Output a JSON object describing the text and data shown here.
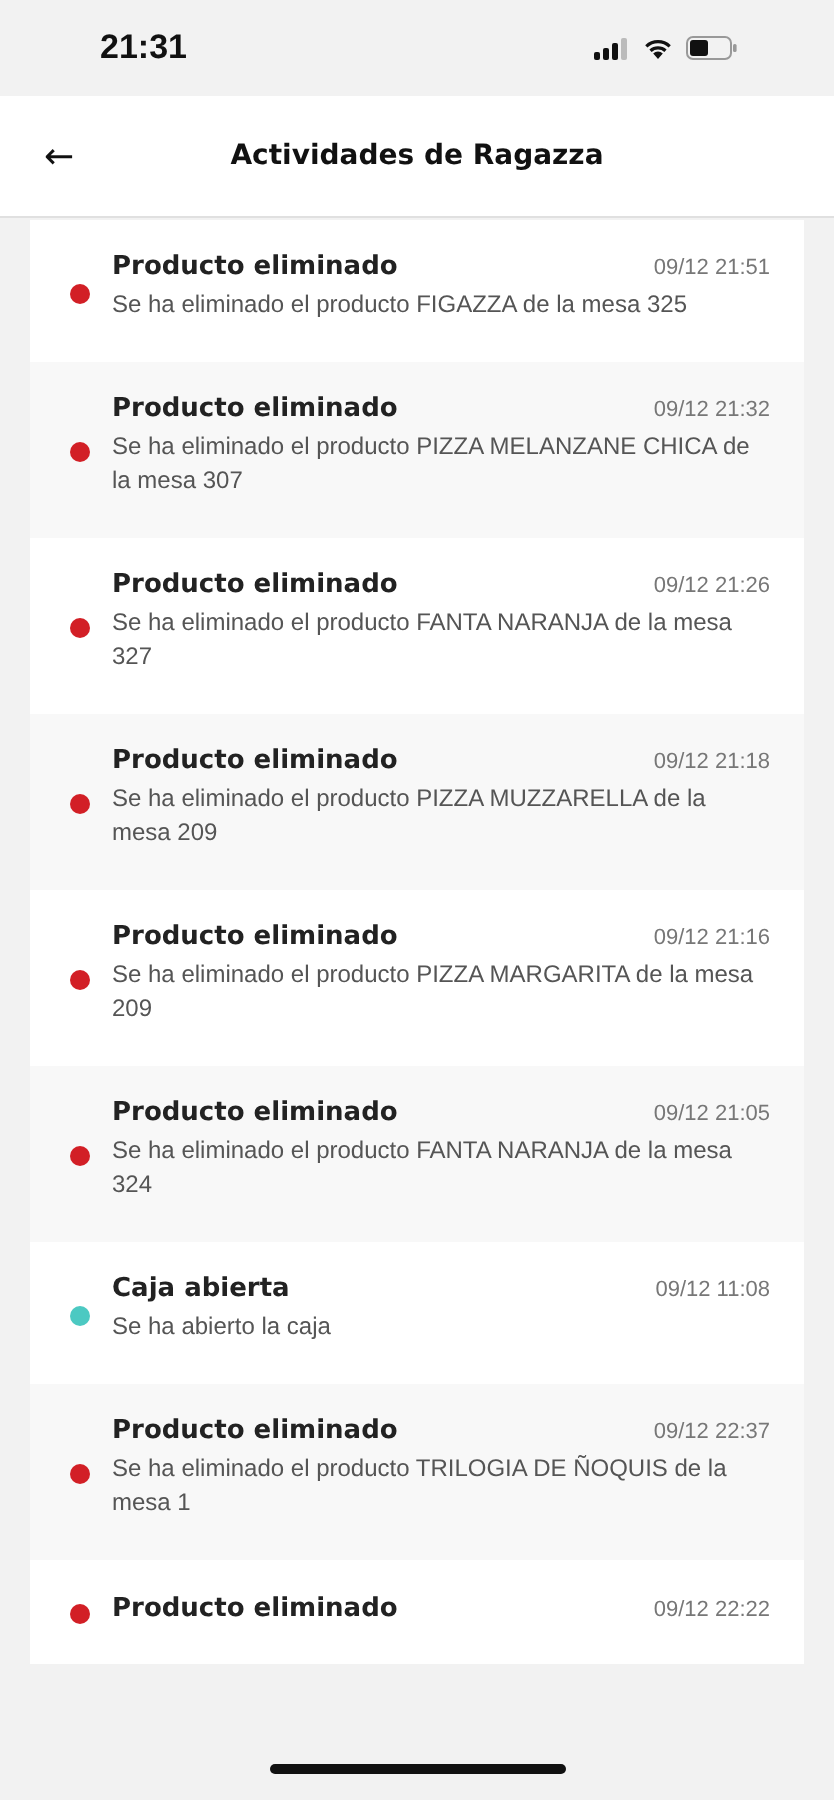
{
  "status_bar": {
    "time": "21:31"
  },
  "header": {
    "back": "←",
    "title": "Actividades de Ragazza"
  },
  "activities": [
    {
      "title": "Producto eliminado",
      "time": "09/12 21:51",
      "description": "Se ha eliminado el producto FIGAZZA de la mesa 325",
      "color": "#d21f26"
    },
    {
      "title": "Producto eliminado",
      "time": "09/12 21:32",
      "description": "Se ha eliminado el producto PIZZA MELANZANE CHICA de la mesa 307",
      "color": "#d21f26"
    },
    {
      "title": "Producto eliminado",
      "time": "09/12 21:26",
      "description": "Se ha eliminado el producto FANTA NARANJA de la mesa 327",
      "color": "#d21f26"
    },
    {
      "title": "Producto eliminado",
      "time": "09/12 21:18",
      "description": "Se ha eliminado el producto PIZZA MUZZARELLA de la mesa 209",
      "color": "#d21f26"
    },
    {
      "title": "Producto eliminado",
      "time": "09/12 21:16",
      "description": "Se ha eliminado el producto PIZZA MARGARITA de la mesa 209",
      "color": "#d21f26"
    },
    {
      "title": "Producto eliminado",
      "time": "09/12 21:05",
      "description": "Se ha eliminado el producto FANTA NARANJA de la mesa 324",
      "color": "#d21f26"
    },
    {
      "title": "Caja abierta",
      "time": "09/12 11:08",
      "description": "Se ha abierto la caja",
      "color": "#4cc9c2"
    },
    {
      "title": "Producto eliminado",
      "time": "09/12 22:37",
      "description": "Se ha eliminado el producto TRILOGIA DE ÑOQUIS de la mesa 1",
      "color": "#d21f26"
    },
    {
      "title": "Producto eliminado",
      "time": "09/12 22:22",
      "color": "#d21f26"
    }
  ]
}
